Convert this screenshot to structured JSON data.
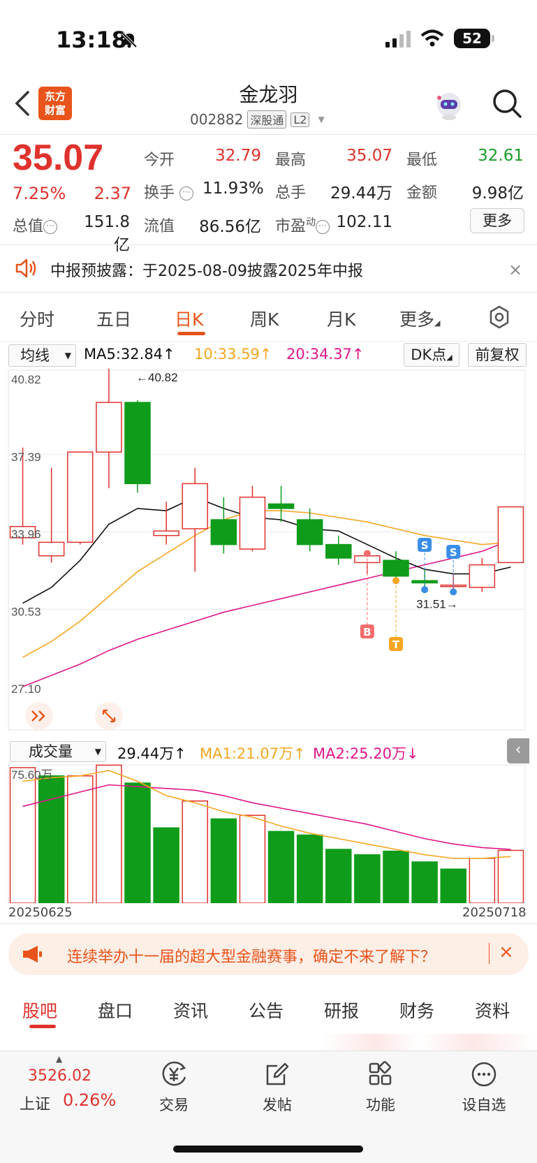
{
  "status_bar": {
    "time": "13:18",
    "battery": "52"
  },
  "header": {
    "title": "金龙羽",
    "code": "002882",
    "tag1": "深股通",
    "tag2": "L2",
    "logo_line1": "东方",
    "logo_line2": "财富"
  },
  "quote": {
    "price": "35.07",
    "pct": "7.25%",
    "change": "2.37",
    "open_label": "今开",
    "open": "32.79",
    "high_label": "最高",
    "high": "35.07",
    "low_label": "最低",
    "low": "32.61",
    "turnover_label": "换手",
    "turnover": "11.93%",
    "volume_label": "总手",
    "volume": "29.44万",
    "amount_label": "金额",
    "amount": "9.98亿",
    "mcap_label": "总值",
    "mcap": "151.8亿",
    "float_label": "流值",
    "float": "86.56亿",
    "pe_label": "市盈",
    "pe_sup": "动",
    "pe": "102.11",
    "more": "更多"
  },
  "notice": {
    "text": "中报预披露：于2025-08-09披露2025年中报",
    "close": "×"
  },
  "tabs": [
    "分时",
    "五日",
    "日K",
    "周K",
    "月K",
    "更多"
  ],
  "chart_controls": {
    "ma_select": "均线",
    "ma5": "MA5:32.84↑",
    "ma10": "10:33.59↑",
    "ma20": "20:34.37↑",
    "dk": "DK点",
    "fq": "前复权",
    "vol_select": "成交量",
    "vol_value": "29.44万↑",
    "vol_ma1": "MA1:21.07万↑",
    "vol_ma2": "MA2:25.20万↓"
  },
  "chart_data": {
    "type": "candlestick",
    "y_ticks": [
      "40.82",
      "37.39",
      "33.96",
      "30.53",
      "27.10"
    ],
    "ylim": [
      27.1,
      40.82
    ],
    "annotations": {
      "high": "←40.82",
      "low": "31.51→",
      "buy": "B",
      "take": "T",
      "sell": "S"
    },
    "candles": [
      {
        "o": 33.7,
        "c": 34.2,
        "h": 37.7,
        "l": 33.4
      },
      {
        "o": 32.9,
        "c": 33.5,
        "h": 36.8,
        "l": 32.6
      },
      {
        "o": 33.5,
        "c": 37.5,
        "h": 37.5,
        "l": 33.4
      },
      {
        "o": 37.5,
        "c": 39.7,
        "h": 41.3,
        "l": 35.9
      },
      {
        "o": 39.7,
        "c": 36.1,
        "h": 39.8,
        "l": 35.7
      },
      {
        "o": 33.8,
        "c": 34.0,
        "h": 35.3,
        "l": 33.4
      },
      {
        "o": 34.1,
        "c": 36.1,
        "h": 36.8,
        "l": 32.2
      },
      {
        "o": 34.5,
        "c": 33.4,
        "h": 35.5,
        "l": 33.0
      },
      {
        "o": 33.2,
        "c": 35.5,
        "h": 36.0,
        "l": 33.1
      },
      {
        "o": 35.2,
        "c": 35.0,
        "h": 36.0,
        "l": 34.4
      },
      {
        "o": 34.5,
        "c": 33.4,
        "h": 35.0,
        "l": 33.1
      },
      {
        "o": 33.4,
        "c": 32.8,
        "h": 33.8,
        "l": 32.5
      },
      {
        "o": 32.6,
        "c": 32.9,
        "h": 33.1,
        "l": 32.1
      },
      {
        "o": 32.7,
        "c": 32.0,
        "h": 33.1,
        "l": 31.8
      },
      {
        "o": 31.8,
        "c": 31.7,
        "h": 32.3,
        "l": 31.5
      },
      {
        "o": 31.6,
        "c": 31.6,
        "h": 32.1,
        "l": 31.2
      },
      {
        "o": 31.5,
        "c": 32.5,
        "h": 32.8,
        "l": 31.3
      },
      {
        "o": 32.6,
        "c": 35.07,
        "h": 35.07,
        "l": 32.61
      }
    ],
    "ma5": [
      30.8,
      31.5,
      32.7,
      34.3,
      35.0,
      34.9,
      35.5,
      35.0,
      34.6,
      34.5,
      34.1,
      34.0,
      33.4,
      32.8,
      32.3,
      32.1,
      32.1,
      32.4
    ],
    "ma10": [
      28.4,
      29.1,
      30.0,
      31.1,
      32.2,
      33.0,
      33.8,
      34.5,
      34.9,
      34.9,
      34.8,
      34.6,
      34.4,
      34.1,
      33.8,
      33.6,
      33.4,
      33.5
    ],
    "ma20": [
      27.1,
      27.6,
      28.1,
      28.7,
      29.2,
      29.6,
      30.0,
      30.4,
      30.7,
      31.0,
      31.3,
      31.6,
      31.9,
      32.2,
      32.5,
      32.8,
      33.1,
      33.6
    ],
    "volume": {
      "y_tick": "75.60万",
      "ylim": [
        0,
        75.6
      ],
      "values": [
        75.6,
        71.0,
        71.0,
        77.0,
        67.0,
        42.0,
        57.0,
        47.0,
        49.0,
        40.0,
        38.0,
        30.0,
        27.0,
        29.0,
        23.0,
        19.0,
        25.0,
        29.44
      ],
      "up": [
        true,
        false,
        true,
        true,
        false,
        false,
        true,
        false,
        true,
        false,
        false,
        false,
        false,
        false,
        false,
        false,
        true,
        true
      ],
      "ma1": [
        68,
        70,
        71,
        74,
        68,
        60,
        56,
        51,
        48,
        43,
        39,
        36,
        33,
        30,
        27,
        25,
        25,
        26
      ],
      "ma2": [
        54,
        58,
        62,
        66,
        65,
        64,
        63,
        60,
        56,
        53,
        50,
        47,
        44,
        40,
        36,
        33,
        31,
        30
      ]
    },
    "date_start": "20250625",
    "date_end": "20250718"
  },
  "promo": {
    "text": "连续举办十一届的超大型金融赛事，确定不来了解下？",
    "close": "×"
  },
  "content_tabs": [
    "股吧",
    "盘口",
    "资讯",
    "公告",
    "研报",
    "财务",
    "资料"
  ],
  "bottom_nav": {
    "index_value": "3526.02",
    "index_name": "上证",
    "index_pct": "0.26%",
    "items": [
      "交易",
      "发帖",
      "功能",
      "设自选"
    ]
  },
  "colors": {
    "up": "#e0322d",
    "down": "#0e9c1a",
    "ma5": "#111111",
    "ma10": "#f5a623",
    "ma20": "#e0168a",
    "accent": "#e8541b"
  }
}
